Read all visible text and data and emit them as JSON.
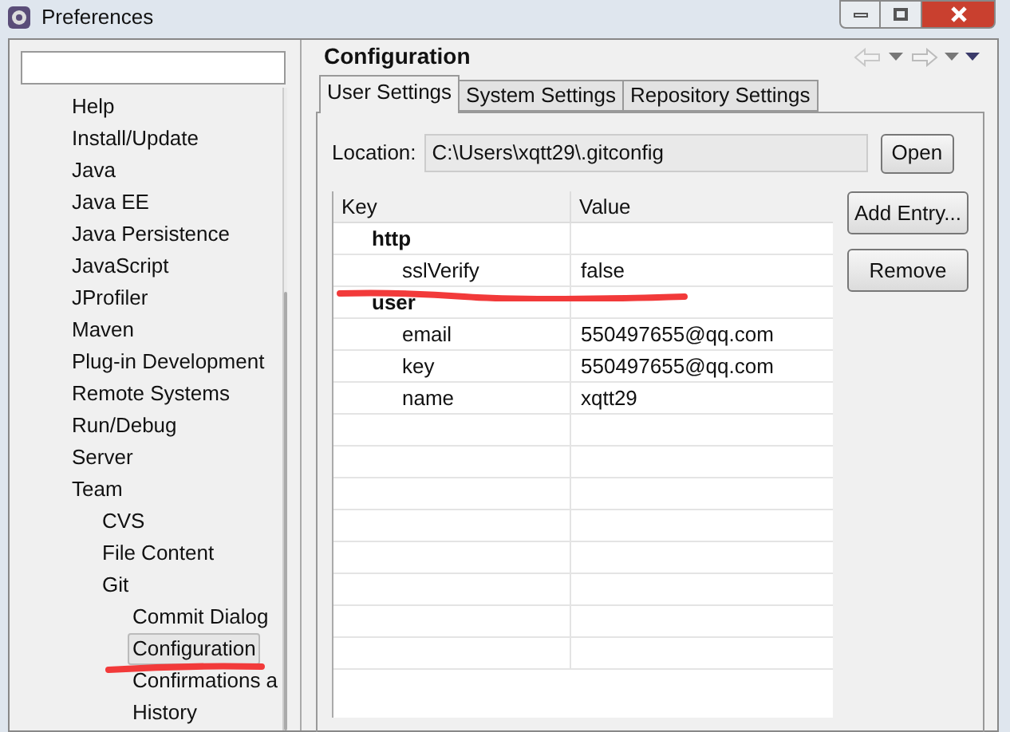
{
  "window": {
    "title": "Preferences"
  },
  "tree": [
    {
      "label": "Help",
      "selected": false
    },
    {
      "label": "Install/Update",
      "selected": false
    },
    {
      "label": "Java",
      "selected": false
    },
    {
      "label": "Java EE",
      "selected": false
    },
    {
      "label": "Java Persistence",
      "selected": false
    },
    {
      "label": "JavaScript",
      "selected": false
    },
    {
      "label": "JProfiler",
      "selected": false
    },
    {
      "label": "Maven",
      "selected": false
    },
    {
      "label": "Plug-in Development",
      "selected": false
    },
    {
      "label": "Remote Systems",
      "selected": false
    },
    {
      "label": "Run/Debug",
      "selected": false
    },
    {
      "label": "Server",
      "selected": false
    },
    {
      "label": "Team",
      "selected": false,
      "children": [
        {
          "label": "CVS",
          "selected": false
        },
        {
          "label": "File Content",
          "selected": false
        },
        {
          "label": "Git",
          "selected": false,
          "children": [
            {
              "label": "Commit Dialog",
              "selected": false
            },
            {
              "label": "Configuration",
              "selected": true
            },
            {
              "label": "Confirmations a",
              "selected": false
            },
            {
              "label": "History",
              "selected": false
            }
          ]
        }
      ]
    }
  ],
  "page": {
    "title": "Configuration"
  },
  "tabs": [
    {
      "label": "User Settings",
      "selected": true
    },
    {
      "label": "System Settings",
      "selected": false
    },
    {
      "label": "Repository Settings",
      "selected": false
    }
  ],
  "location": {
    "label": "Location:",
    "value": "C:\\Users\\xqtt29\\.gitconfig",
    "button": "Open"
  },
  "table": {
    "columns": [
      "Key",
      "Value"
    ],
    "rows": [
      {
        "kind": "section",
        "key": "http"
      },
      {
        "kind": "entry",
        "key": "sslVerify",
        "value": "false"
      },
      {
        "kind": "section",
        "key": "user"
      },
      {
        "kind": "entry",
        "key": "email",
        "value": "550497655@qq.com"
      },
      {
        "kind": "entry",
        "key": "key",
        "value": "550497655@qq.com"
      },
      {
        "kind": "entry",
        "key": "name",
        "value": "xqtt29"
      }
    ]
  },
  "buttons": [
    "Add Entry...",
    "Remove"
  ]
}
